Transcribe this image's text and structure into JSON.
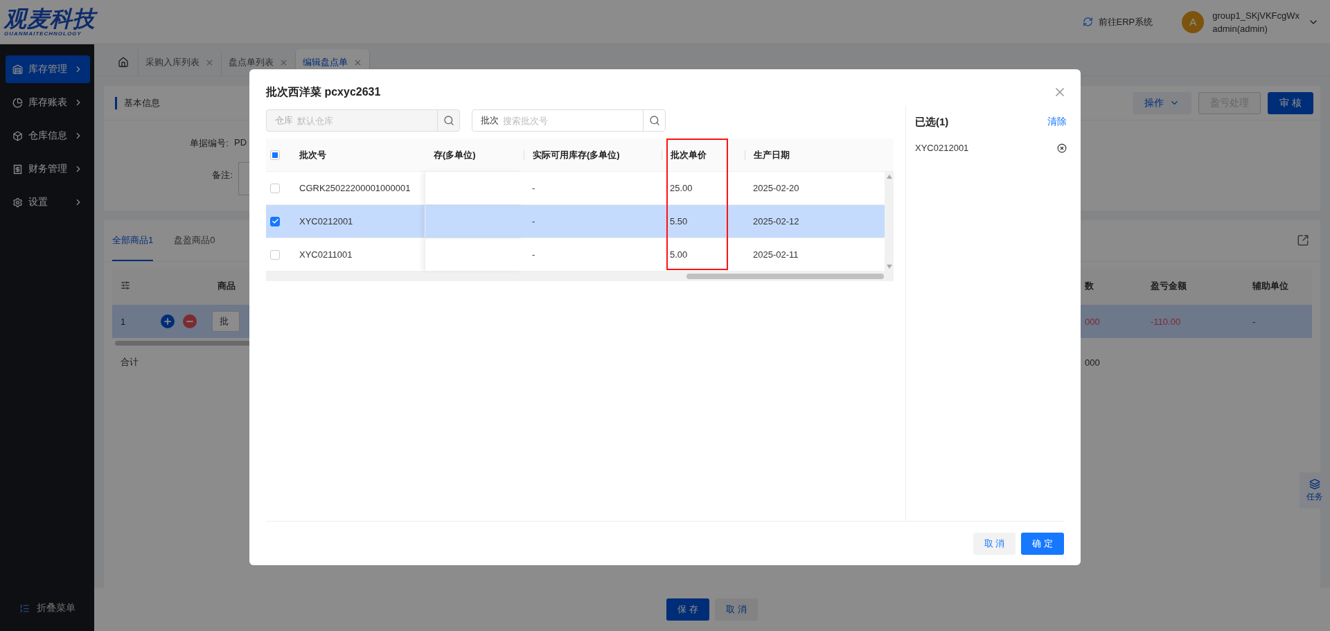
{
  "header": {
    "logo": {
      "title": "观麦科技",
      "subtitle": "GUANMAITECHNOLOGY"
    },
    "erp_link": "前往ERP系统",
    "user": {
      "avatar": "A",
      "name": "group1_SKjVKFcgWx",
      "role": "admin(admin)"
    }
  },
  "sidebar": {
    "items": [
      {
        "label": "库存管理",
        "selected": true
      },
      {
        "label": "库存账表",
        "selected": false
      },
      {
        "label": "仓库信息",
        "selected": false
      },
      {
        "label": "财务管理",
        "selected": false
      },
      {
        "label": "设置",
        "selected": false
      }
    ],
    "collapse": "折叠菜单"
  },
  "tabs": [
    {
      "label": "采购入库列表",
      "selected": false
    },
    {
      "label": "盘点单列表",
      "selected": false
    },
    {
      "label": "编辑盘点单",
      "selected": true
    }
  ],
  "base_info": {
    "title": "基本信息",
    "actions": [
      {
        "label": "操作",
        "kind": "dropdown"
      },
      {
        "label": "盈亏处理",
        "kind": "disabled"
      },
      {
        "label": "审 核",
        "kind": "primary"
      }
    ],
    "fields": [
      {
        "label": "单据编号:",
        "value": "PD"
      },
      {
        "label": "备注:"
      }
    ]
  },
  "goods": {
    "tabs": [
      {
        "label": "全部商品1",
        "selected": true
      },
      {
        "label": "盘盈商品0",
        "selected": false
      }
    ],
    "left_columns": [
      "商品"
    ],
    "right_columns": [
      "数",
      "盈亏金额",
      "辅助单位"
    ],
    "row": {
      "index": "1",
      "cell": "批",
      "qty": "000",
      "amount": "-110.00",
      "unit": "-"
    },
    "total": {
      "label": "合计",
      "value": "000"
    }
  },
  "footer": {
    "buttons": [
      {
        "label": "保 存",
        "kind": "primary"
      },
      {
        "label": "取 消",
        "kind": "default"
      }
    ]
  },
  "float_button": "任务",
  "modal": {
    "title": "批次西洋菜 pcxyc2631",
    "warehouse_search": {
      "label": "仓库",
      "placeholder": "默认仓库"
    },
    "batch_search": {
      "label": "批次",
      "placeholder": "搜索批次号"
    },
    "table": {
      "indeterminate": true,
      "columns": [
        {
          "label": "批次号",
          "highlighted": false
        },
        {
          "label": "存(多单位)",
          "highlighted": false
        },
        {
          "label": "实际可用库存(多单位)",
          "highlighted": false
        },
        {
          "label": "批次单价",
          "highlighted": true
        },
        {
          "label": "生产日期",
          "highlighted": false
        }
      ],
      "rows": [
        {
          "batch": "CGRK25022200001000001",
          "available": "-",
          "price": "25.00",
          "date": "2025-02-20",
          "selected": false
        },
        {
          "batch": "XYC0212001",
          "available": "-",
          "price": "5.50",
          "date": "2025-02-12",
          "selected": true
        },
        {
          "batch": "XYC0211001",
          "available": "-",
          "price": "5.00",
          "date": "2025-02-11",
          "selected": false
        }
      ]
    },
    "selected_panel": {
      "title": "已选(1)",
      "clear": "清除",
      "items": [
        "XYC0212001"
      ]
    },
    "buttons": [
      {
        "label": "取 消",
        "kind": "default"
      },
      {
        "label": "确 定",
        "kind": "primary"
      }
    ]
  }
}
